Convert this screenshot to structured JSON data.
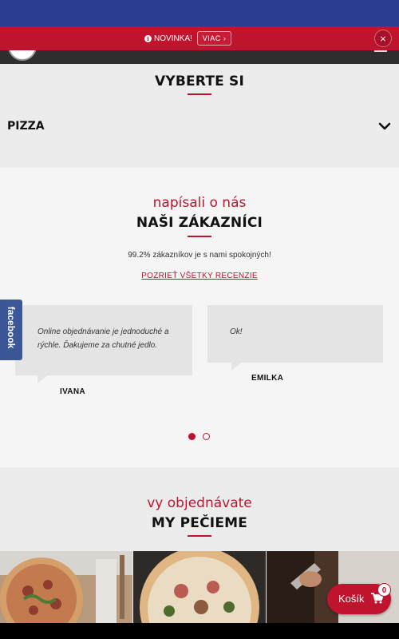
{
  "notice": {
    "text": "NOVINKA!",
    "more_label": "VIAC",
    "close_glyph": "×"
  },
  "pick": {
    "title": "VYBERTE SI",
    "category": "PIZZA"
  },
  "reviews": {
    "subtitle": "napísali o nás",
    "title": "NAŠI ZÁKAZNÍCI",
    "satisfied": "99.2% zákazníkov je s nami spokojných!",
    "all_link": "POZRIEŤ VŠETKY RECENZIE",
    "items": [
      {
        "text": "Online objednávanie je jednoduché a rýchle. Ďakujeme za chutné jedlo.",
        "author": "IVANA"
      },
      {
        "text": "Ok!",
        "author": "EMILKA"
      }
    ],
    "active_slide": 1,
    "slide_count": 2
  },
  "order": {
    "subtitle": "vy objednávate",
    "title": "MY PEČIEME"
  },
  "social": {
    "label": "facebook"
  },
  "cart": {
    "label": "Košík",
    "count": "0"
  },
  "colors": {
    "accent": "#c0132d",
    "top_bar": "#2a3d93",
    "facebook": "#3b5798"
  },
  "icons": [
    "info-icon",
    "close-icon",
    "menu-icon",
    "chevron-down-icon",
    "cart-icon",
    "arrow-right-icon"
  ]
}
